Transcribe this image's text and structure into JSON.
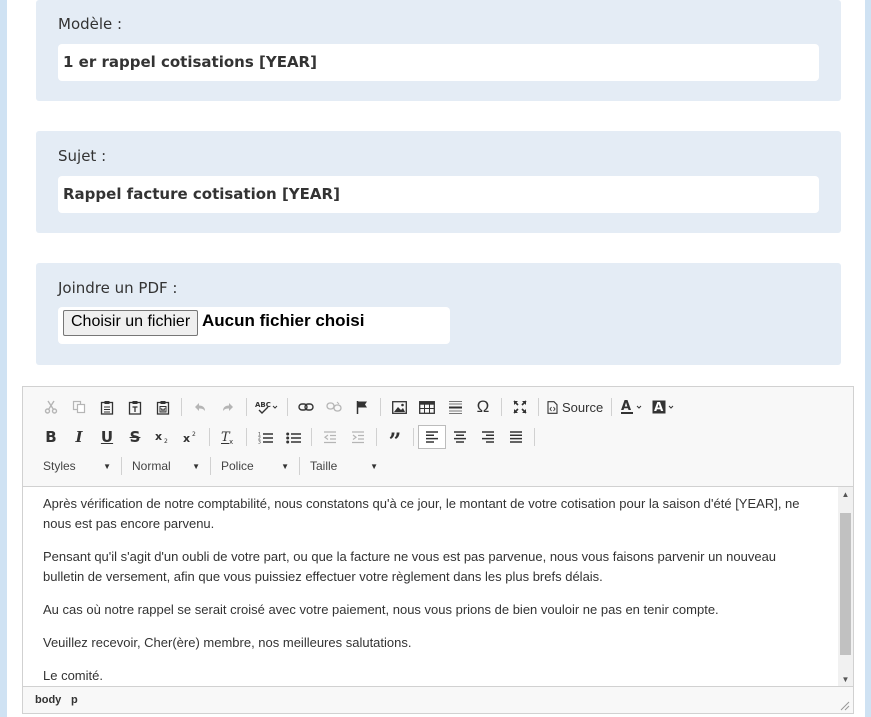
{
  "modele": {
    "label": "Modèle :",
    "value": "1 er rappel cotisations [YEAR]"
  },
  "sujet": {
    "label": "Sujet :",
    "value": "Rappel facture cotisation [YEAR]"
  },
  "pdf": {
    "label": "Joindre un PDF :",
    "button": "Choisir un fichier",
    "status": "Aucun fichier choisi"
  },
  "toolbar": {
    "source_label": "Source",
    "styles": "Styles",
    "format": "Normal",
    "font": "Police",
    "size": "Taille"
  },
  "content": {
    "paragraphs": [
      "Après vérification de notre comptabilité, nous constatons qu'à ce jour, le montant de votre cotisation pour la saison d'été [YEAR], ne nous est pas encore parvenu.",
      "Pensant qu'il s'agit d'un oubli de votre part, ou que la facture ne vous est pas parvenue, nous vous faisons parvenir un nouveau bulletin de versement, afin que vous puissiez effectuer votre règlement dans les plus brefs délais.",
      "Au cas où notre rappel se serait croisé avec votre paiement, nous vous prions de bien vouloir ne pas en tenir compte.",
      "Veuillez recevoir, Cher(ère) membre, nos meilleures salutations.",
      "Le comité."
    ]
  },
  "statusbar": {
    "path": [
      "body",
      "p"
    ]
  }
}
